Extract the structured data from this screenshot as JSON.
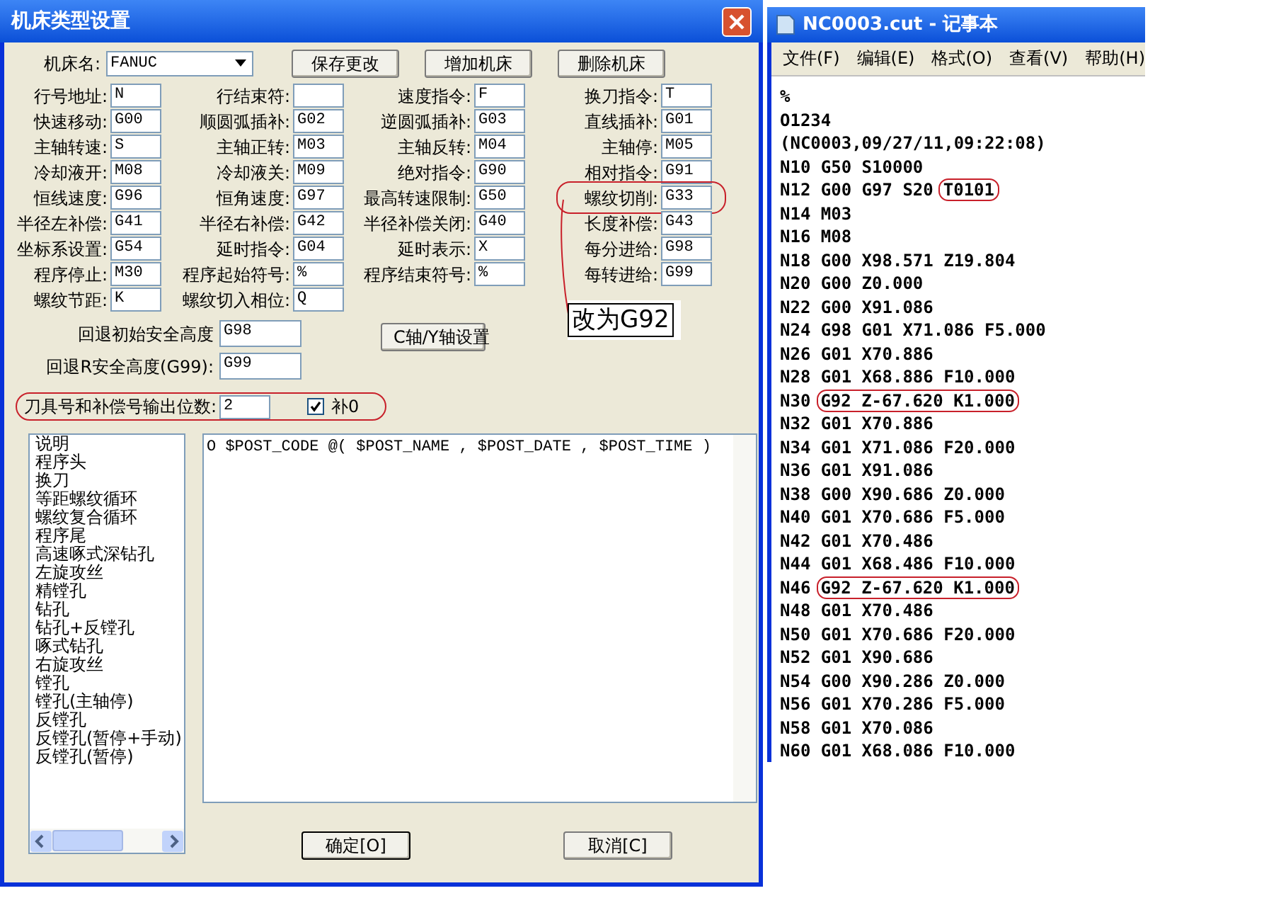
{
  "dialog": {
    "title": "机床类型设置",
    "machine": {
      "label": "机床名:",
      "value": "FANUC"
    },
    "top_buttons": [
      "保存更改",
      "增加机床",
      "删除机床"
    ],
    "field_rows": [
      [
        {
          "label": "行号地址:",
          "value": "N"
        },
        {
          "label": "行结束符:"
        },
        {
          "label": "速度指令:",
          "value": "F"
        },
        {
          "label": "换刀指令:",
          "value": "T"
        }
      ],
      [
        {
          "label": "快速移动:",
          "value": "G00"
        },
        {
          "label": "顺圆弧插补:",
          "value": "G02"
        },
        {
          "label": "逆圆弧插补:",
          "value": "G03"
        },
        {
          "label": "直线插补:",
          "value": "G01"
        }
      ],
      [
        {
          "label": "主轴转速:",
          "value": "S"
        },
        {
          "label": "主轴正转:",
          "value": "M03"
        },
        {
          "label": "主轴反转:",
          "value": "M04"
        },
        {
          "label": "主轴停:",
          "value": "M05"
        }
      ],
      [
        {
          "label": "冷却液开:",
          "value": "M08"
        },
        {
          "label": "冷却液关:",
          "value": "M09"
        },
        {
          "label": "绝对指令:",
          "value": "G90"
        },
        {
          "label": "相对指令:",
          "value": "G91"
        }
      ],
      [
        {
          "label": "恒线速度:",
          "value": "G96"
        },
        {
          "label": "恒角速度:",
          "value": "G97"
        },
        {
          "label": "最高转速限制:",
          "value": "G50"
        },
        {
          "label": "螺纹切削:",
          "value": "G33",
          "circled": true
        }
      ],
      [
        {
          "label": "半径左补偿:",
          "value": "G41"
        },
        {
          "label": "半径右补偿:",
          "value": "G42"
        },
        {
          "label": "半径补偿关闭:",
          "value": "G40"
        },
        {
          "label": "长度补偿:",
          "value": "G43"
        }
      ],
      [
        {
          "label": "坐标系设置:",
          "value": "G54"
        },
        {
          "label": "延时指令:",
          "value": "G04"
        },
        {
          "label": "延时表示:",
          "value": "X"
        },
        {
          "label": "每分进给:",
          "value": "G98"
        }
      ],
      [
        {
          "label": "程序停止:",
          "value": "M30"
        },
        {
          "label": "程序起始符号:",
          "value": "%"
        },
        {
          "label": "程序结束符号:",
          "value": "%"
        },
        {
          "label": "每转进给:",
          "value": "G99"
        }
      ],
      [
        {
          "label": "螺纹节距:",
          "value": "K"
        },
        {
          "label": "螺纹切入相位:",
          "value": "Q"
        }
      ]
    ],
    "callout": "改为G92",
    "retract_rows": [
      {
        "label": "回退初始安全高度",
        "value": "G98"
      },
      {
        "label": "回退R安全高度(G99):",
        "value": "G99"
      }
    ],
    "axis_button": "C轴/Y轴设置",
    "tool_digits": {
      "label": "刀具号和补偿号输出位数:",
      "value": "2",
      "circled": true,
      "checkbox_label": "补0",
      "checked": true
    },
    "sections": [
      "说明",
      "程序头",
      "换刀",
      "等距螺纹循环",
      "螺纹复合循环",
      "程序尾",
      "高速啄式深钻孔",
      "左旋攻丝",
      "精镗孔",
      "钻孔",
      "钻孔+反镗孔",
      "啄式钻孔",
      "右旋攻丝",
      "镗孔",
      "镗孔(主轴停)",
      "反镗孔",
      "反镗孔(暂停+手动)",
      "反镗孔(暂停)"
    ],
    "editor_text": "O $POST_CODE @( $POST_NAME , $POST_DATE , $POST_TIME )",
    "ok_button": "确定[O]",
    "cancel_button": "取消[C]"
  },
  "notepad": {
    "title": "NC0003.cut - 记事本",
    "menu": [
      "文件(F)",
      "编辑(E)",
      "格式(O)",
      "查看(V)",
      "帮助(H)"
    ],
    "lines": [
      {
        "code": "%"
      },
      {
        "code": "O1234"
      },
      {
        "code": "(NC0003,09/27/11,09:22:08)"
      },
      {
        "code": "N10 G50 S10000"
      },
      {
        "code": "N12 G00 G97 S20",
        "circled": "T0101"
      },
      {
        "code": "N14 M03"
      },
      {
        "code": "N16 M08"
      },
      {
        "code": "N18 G00 X98.571 Z19.804"
      },
      {
        "code": "N20 G00 Z0.000"
      },
      {
        "code": "N22 G00 X91.086"
      },
      {
        "code": "N24 G98 G01 X71.086 F5.000"
      },
      {
        "code": "N26 G01 X70.886"
      },
      {
        "code": "N28 G01 X68.886 F10.000"
      },
      {
        "code": "N30",
        "circled": "G92 Z-67.620 K1.000"
      },
      {
        "code": "N32 G01 X70.886"
      },
      {
        "code": "N34 G01 X71.086 F20.000"
      },
      {
        "code": "N36 G01 X91.086"
      },
      {
        "code": "N38 G00 X90.686 Z0.000"
      },
      {
        "code": "N40 G01 X70.686 F5.000"
      },
      {
        "code": "N42 G01 X70.486"
      },
      {
        "code": "N44 G01 X68.486 F10.000"
      },
      {
        "code": "N46",
        "circled": "G92 Z-67.620 K1.000"
      },
      {
        "code": "N48 G01 X70.486"
      },
      {
        "code": "N50 G01 X70.686 F20.000"
      },
      {
        "code": "N52 G01 X90.686"
      },
      {
        "code": "N54 G00 X90.286 Z0.000"
      },
      {
        "code": "N56 G01 X70.286 F5.000"
      },
      {
        "code": "N58 G01 X70.086"
      },
      {
        "code": "N60 G01 X68.086 F10.000"
      }
    ]
  }
}
